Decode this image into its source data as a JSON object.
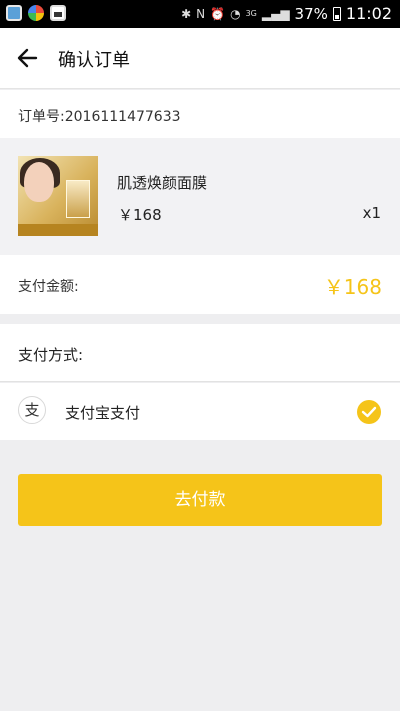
{
  "status_bar": {
    "signal_label": "3G",
    "battery_percent": "37%",
    "time": "11:02"
  },
  "header": {
    "title": "确认订单"
  },
  "order": {
    "number_label": "订单号:2016111477633"
  },
  "product": {
    "name": "肌透焕颜面膜",
    "price": "￥168",
    "quantity": "x1"
  },
  "payment_amount": {
    "label": "支付金额:",
    "value": "￥168"
  },
  "payment_methods": {
    "title": "支付方式:",
    "options": [
      {
        "icon": "alipay-icon",
        "icon_glyph": "支",
        "label": "支付宝支付",
        "selected": true
      }
    ]
  },
  "pay_button": {
    "label": "去付款"
  },
  "colors": {
    "accent": "#f5c419",
    "background": "#eeeef0"
  }
}
